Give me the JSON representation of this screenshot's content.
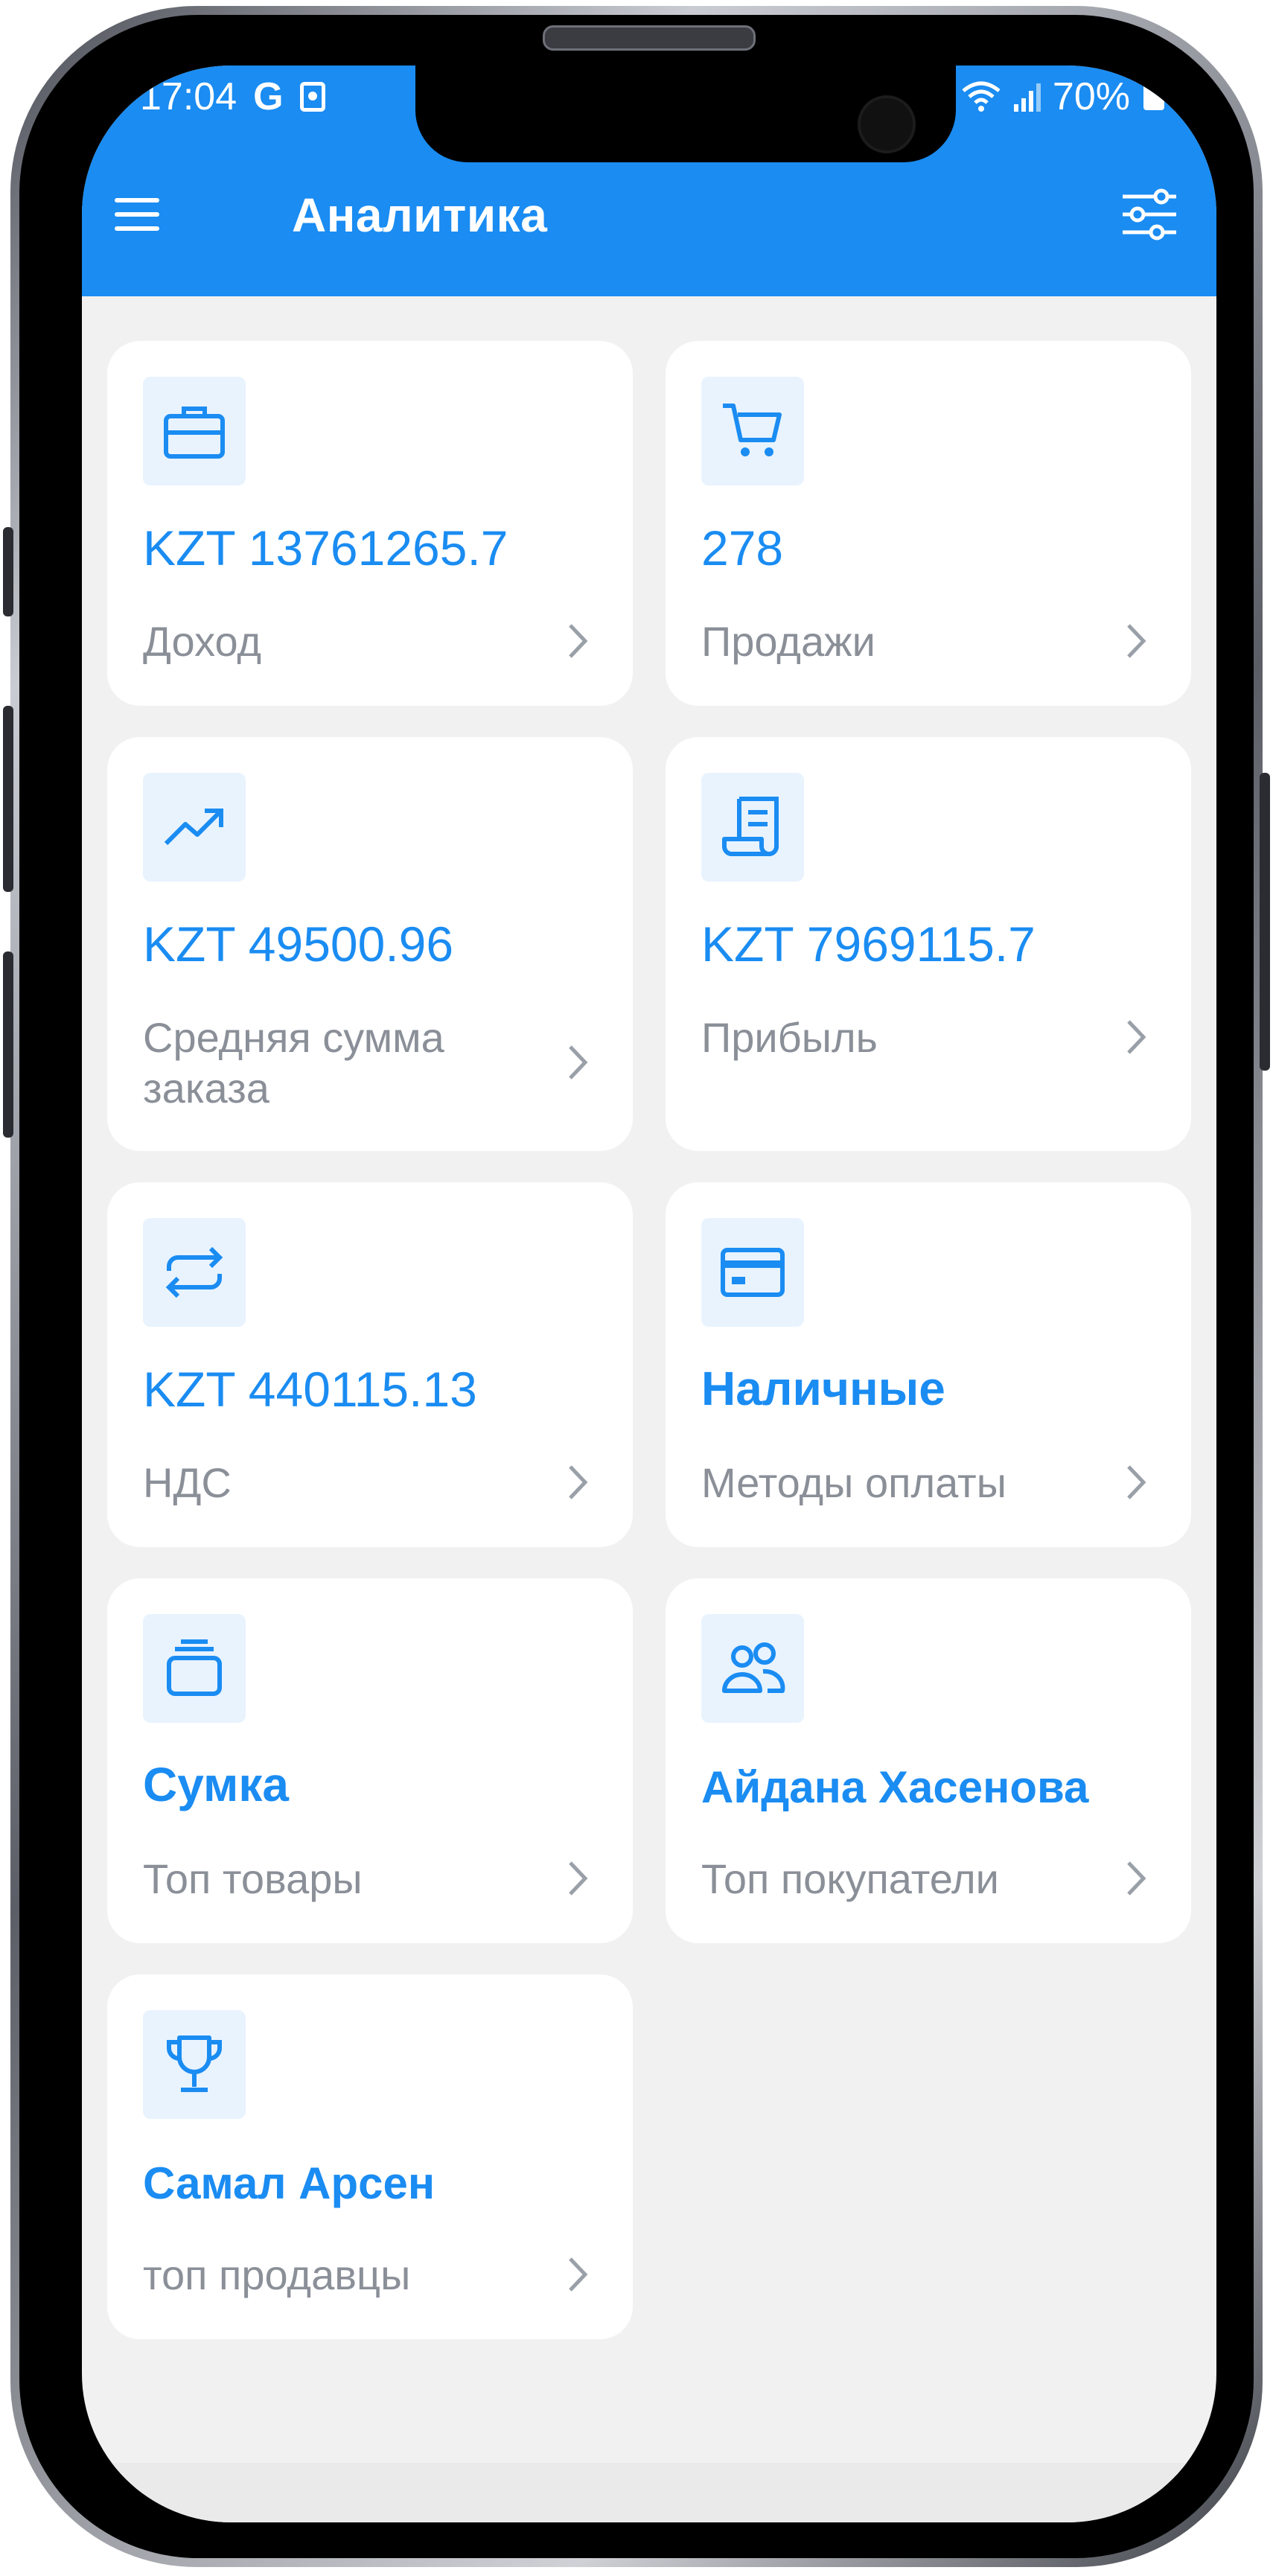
{
  "status_bar": {
    "time": "17:04",
    "g_label": "G",
    "battery": "70%"
  },
  "app_bar": {
    "title": "Аналитика",
    "menu_icon": "hamburger-menu-icon",
    "filter_icon": "sliders-filter-icon"
  },
  "colors": {
    "accent": "#1a8cf2",
    "icon_bg": "#e8f3fe",
    "label_gray": "#8a8f98",
    "background": "#f1f1f1"
  },
  "cards": [
    {
      "value": "KZT 13761265.7",
      "label": "Доход",
      "icon": "briefcase-icon"
    },
    {
      "value": "278",
      "label": "Продажи",
      "icon": "shopping-cart-icon"
    },
    {
      "value": "KZT 49500.96",
      "label": "Средняя сумма заказа",
      "icon": "trending-up-icon"
    },
    {
      "value": "KZT 7969115.7",
      "label": "Прибыль",
      "icon": "receipt-icon"
    },
    {
      "value": "KZT 440115.13",
      "label": "НДС",
      "icon": "repeat-arrows-icon"
    },
    {
      "value": "Наличные",
      "label": "Методы оплаты",
      "icon": "credit-card-icon"
    },
    {
      "value": "Сумка",
      "label": "Топ товары",
      "icon": "product-box-icon"
    },
    {
      "value": "Айдана Хасенова",
      "label": "Топ покупатели",
      "icon": "users-icon"
    },
    {
      "value": "Самал Арсен",
      "label": "топ продавцы",
      "icon": "trophy-icon"
    }
  ]
}
